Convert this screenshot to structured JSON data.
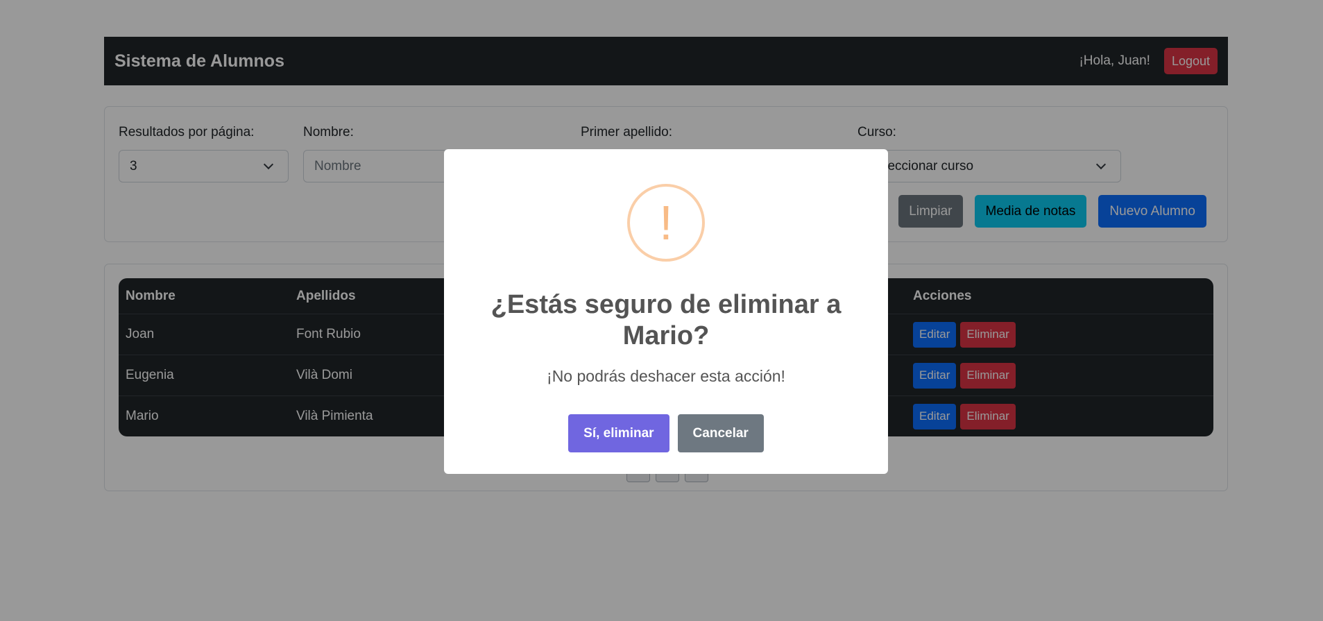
{
  "navbar": {
    "brand": "Sistema de Alumnos",
    "greeting": "¡Hola, Juan!",
    "logout_label": "Logout"
  },
  "filters": {
    "per_page_label": "Resultados por página:",
    "per_page_value": "3",
    "name_label": "Nombre:",
    "name_placeholder": "Nombre",
    "surname_label": "Primer apellido:",
    "course_label": "Curso:",
    "course_value": "Seleccionar curso",
    "clear_label": "Limpiar",
    "average_label": "Media de notas",
    "new_student_label": "Nuevo Alumno"
  },
  "table": {
    "headers": {
      "name": "Nombre",
      "surnames": "Apellidos",
      "actions": "Acciones"
    },
    "rows": [
      {
        "name": "Joan",
        "surnames": "Font Rubio",
        "edit": "Editar",
        "delete": "Eliminar"
      },
      {
        "name": "Eugenia",
        "surnames": "Vilà Domi",
        "edit": "Editar",
        "delete": "Eliminar"
      },
      {
        "name": "Mario",
        "surnames": "Vilà Pimienta",
        "edit": "Editar",
        "delete": "Eliminar"
      }
    ]
  },
  "modal": {
    "icon": "!",
    "icon_name": "warning-icon",
    "title": "¿Estás seguro de eliminar a Mario?",
    "text": "¡No podrás deshacer esta acción!",
    "confirm_label": "Sí, eliminar",
    "cancel_label": "Cancelar"
  },
  "colors": {
    "navbar_bg": "#212529",
    "danger": "#dc3545",
    "primary": "#0d6efd",
    "info": "#0dcaf0",
    "secondary": "#6c757d",
    "confirm": "#7066e0",
    "warning_icon": "#f8bb86"
  }
}
